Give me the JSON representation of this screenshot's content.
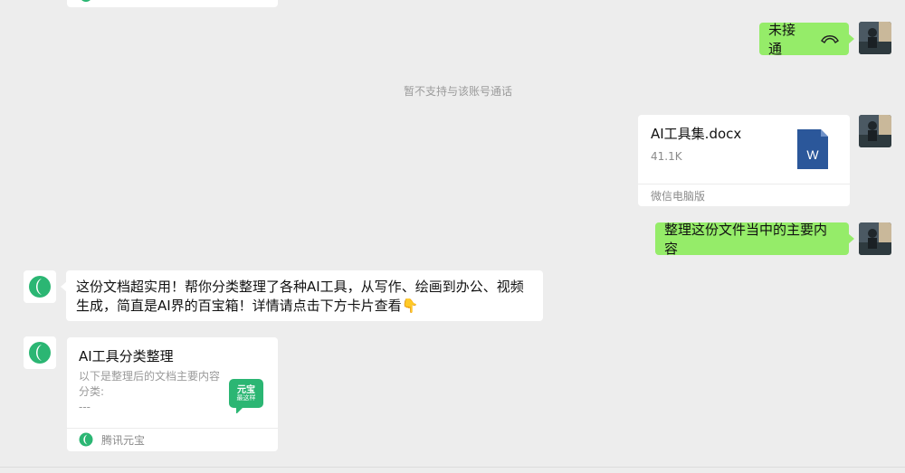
{
  "top_card": {
    "note": "partial card at top"
  },
  "messages": {
    "call": {
      "text": "未接通",
      "icon": "phone-hangup-icon"
    },
    "system_notice": "暂不支持与该账号通话",
    "file": {
      "name": "AI工具集.docx",
      "size": "41.1K",
      "source": "微信电脑版",
      "icon_letter": "W"
    },
    "request": "整理这份文件当中的主要内容",
    "bot_reply": "这份文档超实用！帮你分类整理了各种AI工具，从写作、绘画到办公、视频生成，简直是AI界的百宝箱！详情请点击下方卡片查看👇",
    "card": {
      "title": "AI工具分类整理",
      "desc": "以下是整理后的文档主要内容分类:",
      "dashes": "---",
      "thumb_line1": "元宝",
      "thumb_line2": "最这样",
      "footer": "腾讯元宝"
    }
  },
  "colors": {
    "bubble_green": "#95ec69",
    "bot_green": "#2bb673",
    "word_blue": "#2b579a"
  }
}
